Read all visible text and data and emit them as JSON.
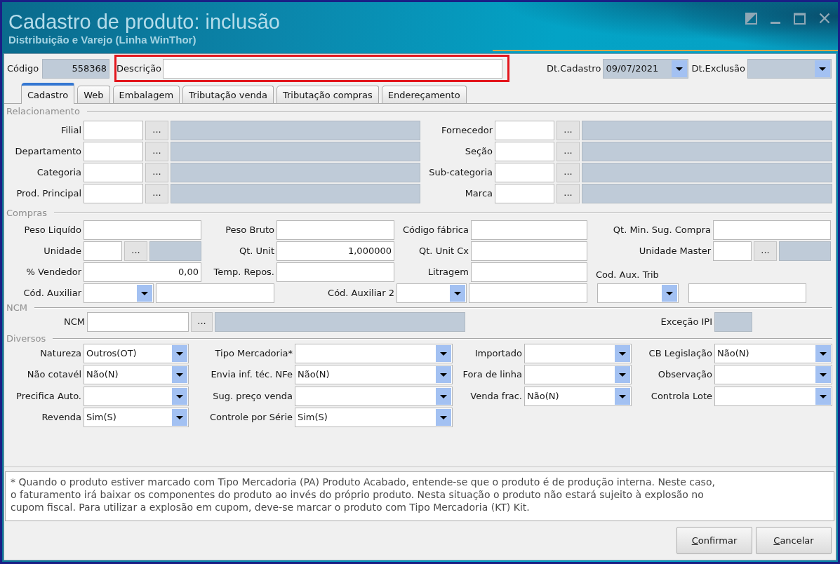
{
  "window": {
    "title": "Cadastro de produto: inclusão",
    "subtitle": "Distribuição e Varejo (Linha WinThor)"
  },
  "header": {
    "code": {
      "label": "Código",
      "value": "558368"
    },
    "description": {
      "label": "Descrição",
      "highlighted": true
    },
    "dates": [
      {
        "label": "Dt.Cadastro",
        "value": "09/07/2021"
      },
      {
        "label": "Dt.Exclusão"
      }
    ]
  },
  "tabs": [
    {
      "label": "Cadastro",
      "selected": true
    },
    {
      "label": "Web",
      "selected": false
    },
    {
      "label": "Embalagem",
      "selected": false
    },
    {
      "label": "Tributação venda",
      "selected": false
    },
    {
      "label": "Tributação compras",
      "selected": false
    },
    {
      "label": "Endereçamento",
      "selected": false
    }
  ],
  "sections": [
    {
      "title": "Relacionamento",
      "fields": [
        {
          "label": "Filial",
          "kind": "lookup",
          "button": "..."
        },
        {
          "label": "Fornecedor",
          "kind": "lookup",
          "button": "..."
        },
        {
          "label": "Departamento",
          "kind": "lookup",
          "button": "..."
        },
        {
          "label": "Seção",
          "kind": "lookup",
          "button": "..."
        },
        {
          "label": "Categoria",
          "kind": "lookup",
          "button": "..."
        },
        {
          "label": "Sub-categoria",
          "kind": "lookup",
          "button": "..."
        },
        {
          "label": "Prod. Principal",
          "kind": "lookup",
          "button": "..."
        },
        {
          "label": "Marca",
          "kind": "lookup",
          "button": "..."
        }
      ]
    },
    {
      "title": "Compras",
      "fields": [
        {
          "label": "Peso Liquído",
          "kind": "text"
        },
        {
          "label": "Peso Bruto",
          "kind": "text"
        },
        {
          "label": "Código fábrica",
          "kind": "text"
        },
        {
          "label": "Qt. Min. Sug. Compra",
          "kind": "text"
        },
        {
          "label": "Unidade",
          "kind": "lookup",
          "button": "..."
        },
        {
          "label": "Qt. Unit",
          "kind": "number",
          "value": "1,000000"
        },
        {
          "label": "Qt. Unit Cx",
          "kind": "text"
        },
        {
          "label": "Unidade Master",
          "kind": "lookup",
          "button": "..."
        },
        {
          "label": "% Vendedor",
          "kind": "number",
          "value": "0,00"
        },
        {
          "label": "Temp. Repos.",
          "kind": "text"
        },
        {
          "label": "Litragem",
          "kind": "text"
        },
        {
          "label": "Cod. Aux. Trib",
          "kind": "captioned"
        },
        {
          "label": "Cód. Auxiliar",
          "kind": "combo_text"
        },
        {
          "label": "Cód. Auxiliar 2",
          "kind": "combo_text"
        }
      ]
    },
    {
      "title": "NCM",
      "fields": [
        {
          "label": "NCM",
          "kind": "lookup",
          "button": "..."
        },
        {
          "label": "Exceção IPI",
          "kind": "readonly"
        }
      ]
    },
    {
      "title": "Diversos",
      "fields": [
        {
          "label": "Natureza",
          "kind": "combo",
          "value": "Outros(OT)"
        },
        {
          "label": "Tipo Mercadoria*",
          "kind": "combo"
        },
        {
          "label": "Importado",
          "kind": "combo"
        },
        {
          "label": "CB Legislação",
          "kind": "combo",
          "value": "Não(N)"
        },
        {
          "label": "Não cotavél",
          "kind": "combo",
          "value": "Não(N)"
        },
        {
          "label": "Envia inf. téc. NFe",
          "kind": "combo",
          "value": "Não(N)"
        },
        {
          "label": "Fora de linha",
          "kind": "combo"
        },
        {
          "label": "Observação",
          "kind": "combo"
        },
        {
          "label": "Precifica Auto.",
          "kind": "combo"
        },
        {
          "label": "Sug. preço venda",
          "kind": "combo"
        },
        {
          "label": "Venda frac.",
          "kind": "combo",
          "value": "Não(N)"
        },
        {
          "label": "Controla Lote",
          "kind": "combo"
        },
        {
          "label": "Revenda",
          "kind": "combo",
          "value": "Sim(S)"
        },
        {
          "label": "Controle por Série",
          "kind": "combo",
          "value": "Sim(S)"
        }
      ]
    }
  ],
  "note": "* Quando o produto estiver marcado com Tipo Mercadoria (PA) Produto Acabado, entende-se que o produto é de produção interna. Neste caso, o faturamento irá baixar os componentes do produto ao invés do próprio produto. Nesta situação o produto não estará sujeito à explosão no cupom fiscal. Para utilizar a explosão em cupom, deve-se marcar o produto com Tipo Mercadoria (KT) Kit.",
  "buttons": [
    "Confirmar",
    "Cancelar"
  ]
}
